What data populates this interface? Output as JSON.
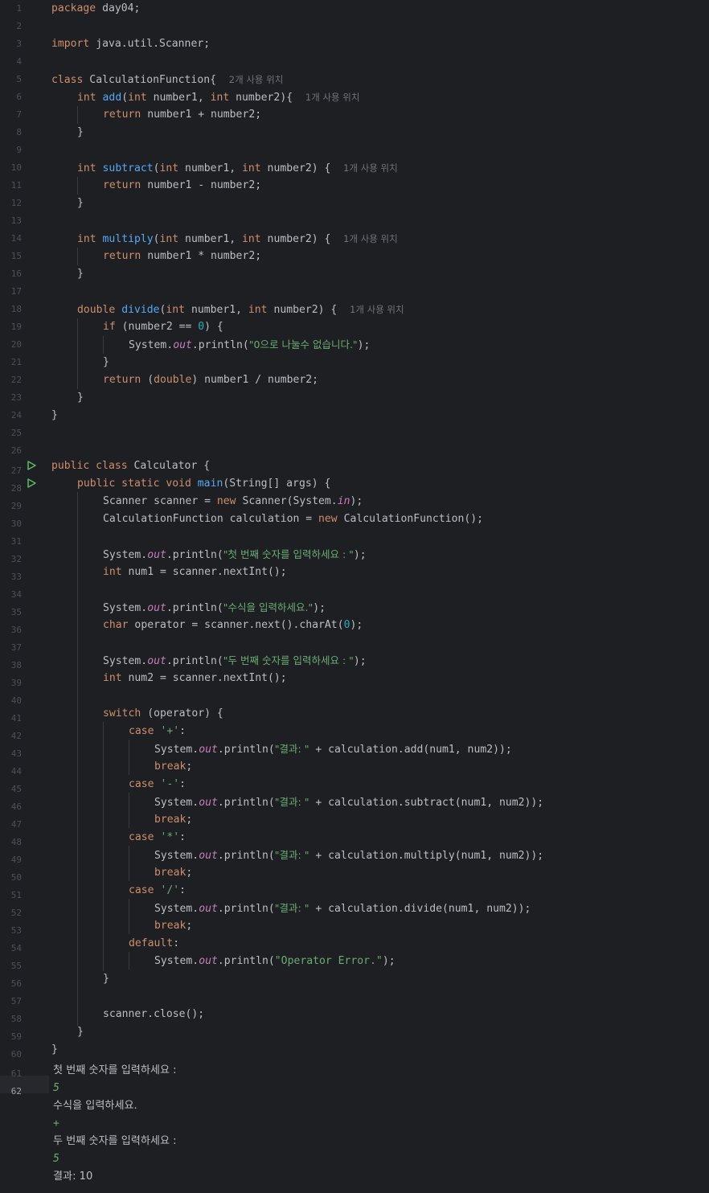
{
  "line_numbers": [
    "1",
    "2",
    "3",
    "4",
    "5",
    "6",
    "7",
    "8",
    "9",
    "10",
    "11",
    "12",
    "13",
    "14",
    "15",
    "16",
    "17",
    "18",
    "19",
    "20",
    "21",
    "22",
    "23",
    "24",
    "25",
    "26",
    "27",
    "28",
    "29",
    "30",
    "31",
    "32",
    "33",
    "34",
    "35",
    "36",
    "37",
    "38",
    "39",
    "40",
    "41",
    "42",
    "43",
    "44",
    "45",
    "46",
    "47",
    "48",
    "49",
    "50",
    "51",
    "52",
    "53",
    "54",
    "55",
    "56",
    "57",
    "58",
    "59",
    "60",
    "61",
    "62"
  ],
  "code": {
    "l1": {
      "kw": "package",
      "rest": " day04;"
    },
    "l3": {
      "kw": "import",
      "rest": " java.util.Scanner;"
    },
    "l5": {
      "kw": "class",
      "rest": " CalculationFunction{",
      "hint": "2개 사용 위치"
    },
    "l6": {
      "kw1": "int",
      "fn": "add",
      "p1": "(",
      "kw2": "int",
      "p2": " number1, ",
      "kw3": "int",
      "p3": " number2){",
      "hint": "1개 사용 위치"
    },
    "l7": {
      "kw": "return",
      "rest": " number1 + number2;"
    },
    "l8": {
      "rest": "}"
    },
    "l10": {
      "kw1": "int",
      "fn": "subtract",
      "p1": "(",
      "kw2": "int",
      "p2": " number1, ",
      "kw3": "int",
      "p3": " number2) {",
      "hint": "1개 사용 위치"
    },
    "l11": {
      "kw": "return",
      "rest": " number1 - number2;"
    },
    "l12": {
      "rest": "}"
    },
    "l14": {
      "kw1": "int",
      "fn": "multiply",
      "p1": "(",
      "kw2": "int",
      "p2": " number1, ",
      "kw3": "int",
      "p3": " number2) {",
      "hint": "1개 사용 위치"
    },
    "l15": {
      "kw": "return",
      "rest": " number1 * number2;"
    },
    "l16": {
      "rest": "}"
    },
    "l18": {
      "kw1": "double",
      "fn": "divide",
      "p1": "(",
      "kw2": "int",
      "p2": " number1, ",
      "kw3": "int",
      "p3": " number2) {",
      "hint": "1개 사용 위치"
    },
    "l19": {
      "kw": "if",
      "p1": " (number2 == ",
      "num": "0",
      "p2": ") {"
    },
    "l20": {
      "p1": "System.",
      "fld": "out",
      "p2": ".println(",
      "str": "\"0으로 나눌수 없습니다.\"",
      "p3": ");"
    },
    "l21": {
      "rest": "}"
    },
    "l22": {
      "kw1": "return",
      "p1": " (",
      "kw2": "double",
      "p2": ") number1 / number2;"
    },
    "l23": {
      "rest": "}"
    },
    "l24": {
      "rest": "}"
    },
    "l27": {
      "kw": "public class",
      "rest": " Calculator {"
    },
    "l28": {
      "kw": "public static void",
      "fn": "main",
      "rest": "(String[] args) {"
    },
    "l29": {
      "p1": "Scanner scanner = ",
      "kw": "new",
      "p2": " Scanner(System.",
      "fld": "in",
      "p3": ");"
    },
    "l30": {
      "p1": "CalculationFunction calculation = ",
      "kw": "new",
      "p2": " CalculationFunction();"
    },
    "l32": {
      "p1": "System.",
      "fld": "out",
      "p2": ".println(",
      "str": "\"첫 번째 숫자를 입력하세요 : \"",
      "p3": ");"
    },
    "l33": {
      "kw": "int",
      "rest": " num1 = scanner.nextInt();"
    },
    "l35": {
      "p1": "System.",
      "fld": "out",
      "p2": ".println(",
      "str": "\"수식을 입력하세요.\"",
      "p3": ");"
    },
    "l36": {
      "kw": "char",
      "p1": " operator = scanner.next().charAt(",
      "num": "0",
      "p2": ");"
    },
    "l38": {
      "p1": "System.",
      "fld": "out",
      "p2": ".println(",
      "str": "\"두 번째 숫자를 입력하세요 : \"",
      "p3": ");"
    },
    "l39": {
      "kw": "int",
      "rest": " num2 = scanner.nextInt();"
    },
    "l41": {
      "kw": "switch",
      "rest": " (operator) {"
    },
    "l42": {
      "kw": "case",
      "str": "'+'",
      "rest": ":"
    },
    "l43": {
      "p1": "System.",
      "fld": "out",
      "p2": ".println(",
      "str": "\"결과: \"",
      "p3": " + calculation.add(num1, num2));"
    },
    "l44": {
      "kw": "break",
      "rest": ";"
    },
    "l45": {
      "kw": "case",
      "str": "'-'",
      "rest": ":"
    },
    "l46": {
      "p1": "System.",
      "fld": "out",
      "p2": ".println(",
      "str": "\"결과: \"",
      "p3": " + calculation.subtract(num1, num2));"
    },
    "l47": {
      "kw": "break",
      "rest": ";"
    },
    "l48": {
      "kw": "case",
      "str": "'*'",
      "rest": ":"
    },
    "l49": {
      "p1": "System.",
      "fld": "out",
      "p2": ".println(",
      "str": "\"결과: \"",
      "p3": " + calculation.multiply(num1, num2));"
    },
    "l50": {
      "kw": "break",
      "rest": ";"
    },
    "l51": {
      "kw": "case",
      "str": "'/'",
      "rest": ":"
    },
    "l52": {
      "p1": "System.",
      "fld": "out",
      "p2": ".println(",
      "str": "\"결과: \"",
      "p3": " + calculation.divide(num1, num2));"
    },
    "l53": {
      "kw": "break",
      "rest": ";"
    },
    "l54": {
      "kw": "default",
      "rest": ":"
    },
    "l55": {
      "p1": "System.",
      "fld": "out",
      "p2": ".println(",
      "str": "\"Operator Error.\"",
      "p3": ");"
    },
    "l56": {
      "rest": "}"
    },
    "l58": {
      "rest": "scanner.close();"
    },
    "l59": {
      "rest": "}"
    },
    "l60": {
      "rest": "}"
    }
  },
  "console": {
    "o1": "첫 번째 숫자를 입력하세요 :",
    "i1": "5",
    "o2": "수식을 입력하세요.",
    "i2": "+",
    "o3": "두 번째 숫자를 입력하세요 :",
    "i3": "5",
    "o4": "결과: 10"
  },
  "colors": {
    "background": "#1e1f22",
    "keyword": "#cf8e6d",
    "function": "#56a8f5",
    "string": "#6aab73",
    "number": "#2aacb8",
    "field": "#c77dbb",
    "run_icon": "#5fb865"
  }
}
